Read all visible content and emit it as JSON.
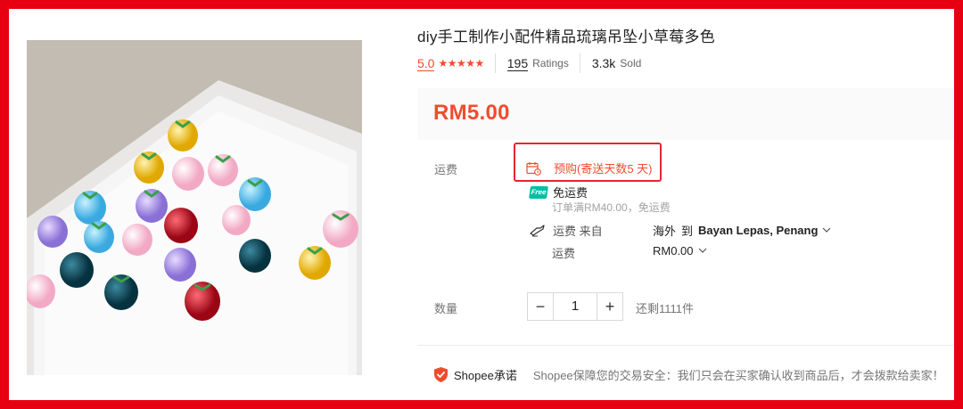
{
  "product": {
    "title": "diy手工制作小配件精品琉璃吊坠小草莓多色",
    "rating_score": "5.0",
    "stars": "★★★★★",
    "ratings_count": "195",
    "ratings_label": "Ratings",
    "sold_count": "3.3k",
    "sold_label": "Sold",
    "price": "RM5.00"
  },
  "shipping": {
    "label": "运费",
    "preorder_text": "预购(寄送天数5 天)",
    "free_badge": "Free",
    "free_title": "免运费",
    "free_condition": "订单满RM40.00，免运费",
    "from_label": "运费 来自",
    "origin": "海外",
    "to": "到",
    "destination": "Bayan Lepas, Penang",
    "fee_label": "运费",
    "fee_value": "RM0.00"
  },
  "quantity": {
    "label": "数量",
    "minus": "−",
    "value": "1",
    "plus": "+",
    "stock": "还剩1111件"
  },
  "guarantee": {
    "brand": "Shopee承诺",
    "text": "Shopee保障您的交易安全：我们只会在买家确认收到商品后，才会拨款给卖家！"
  },
  "colors": {
    "accent": "#ee4d2d",
    "highlight_border": "#e3262f",
    "frame": "#e60012",
    "free_badge": "#00bfa5"
  },
  "icons": [
    "calendar-icon",
    "free-shipping-badge",
    "truck-icon",
    "chevron-down-icon",
    "shield-icon"
  ]
}
